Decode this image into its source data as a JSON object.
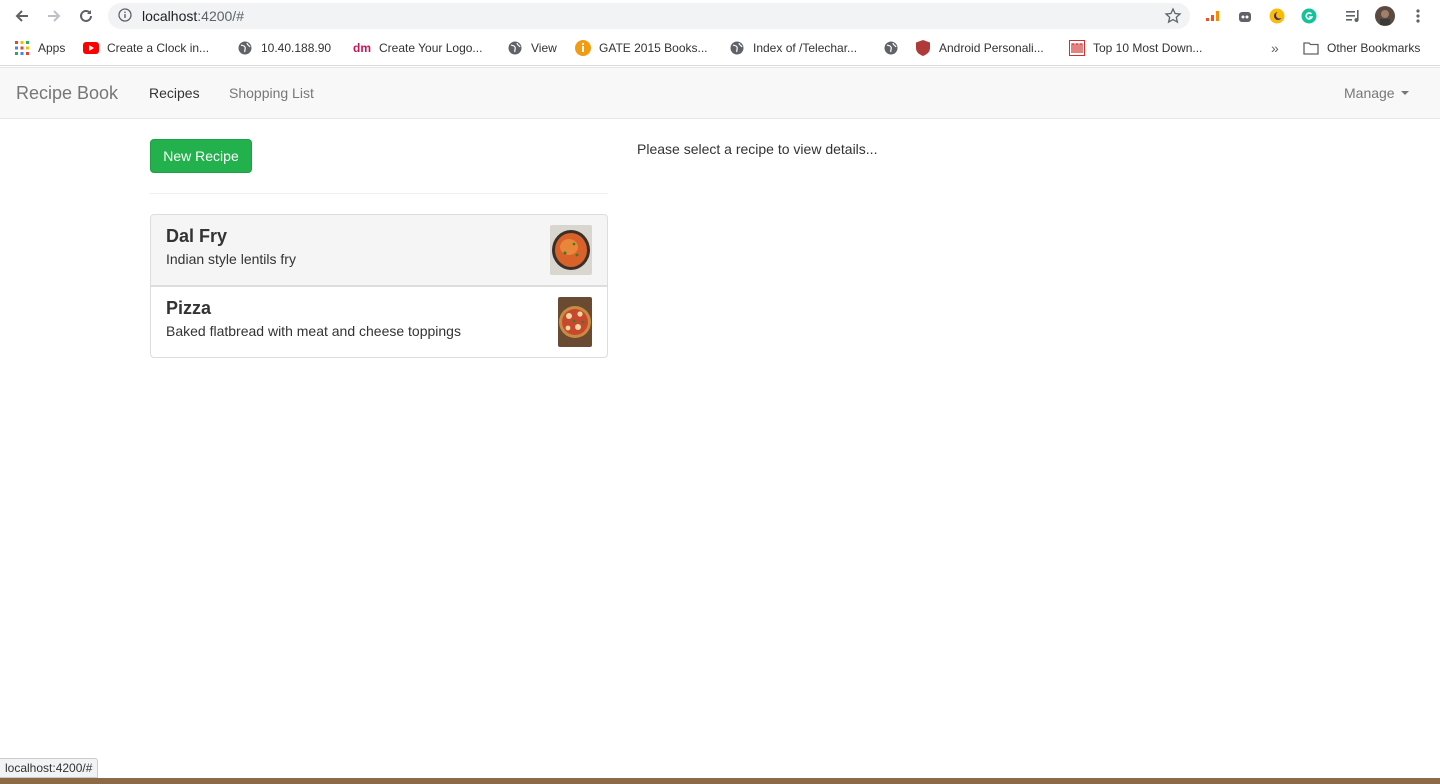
{
  "browser": {
    "url_host": "localhost",
    "url_rest": ":4200/#",
    "status_url": "localhost:4200/#"
  },
  "bookmarks": [
    {
      "label": "Apps",
      "icon": "apps-grid-icon"
    },
    {
      "label": "Create a Clock in...",
      "icon": "youtube-icon"
    },
    {
      "label": "10.40.188.90",
      "icon": "globe-icon"
    },
    {
      "label": "Create Your Logo...",
      "icon": "dm-logo-icon"
    },
    {
      "label": "View",
      "icon": "globe-icon"
    },
    {
      "label": "GATE 2015 Books...",
      "icon": "info-orange-icon"
    },
    {
      "label": "Index of /Telechar...",
      "icon": "globe-icon"
    },
    {
      "label": "",
      "icon": "globe-icon"
    },
    {
      "label": "Android Personali...",
      "icon": "shield-icon"
    },
    {
      "label": "Top 10 Most Down...",
      "icon": "red-logo-icon"
    }
  ],
  "other_bookmarks": "Other Bookmarks",
  "navbar": {
    "brand": "Recipe Book",
    "links": [
      "Recipes",
      "Shopping List"
    ],
    "manage": "Manage"
  },
  "content": {
    "new_recipe_label": "New Recipe",
    "placeholder": "Please select a recipe to view details...",
    "recipes": [
      {
        "name": "Dal Fry",
        "description": "Indian style lentils fry",
        "image": "dal-fry-photo"
      },
      {
        "name": "Pizza",
        "description": "Baked flatbread with meat and cheese toppings",
        "image": "pizza-photo"
      }
    ]
  },
  "colors": {
    "accent_green": "#22b14c",
    "navbar_bg": "#f8f8f8"
  }
}
